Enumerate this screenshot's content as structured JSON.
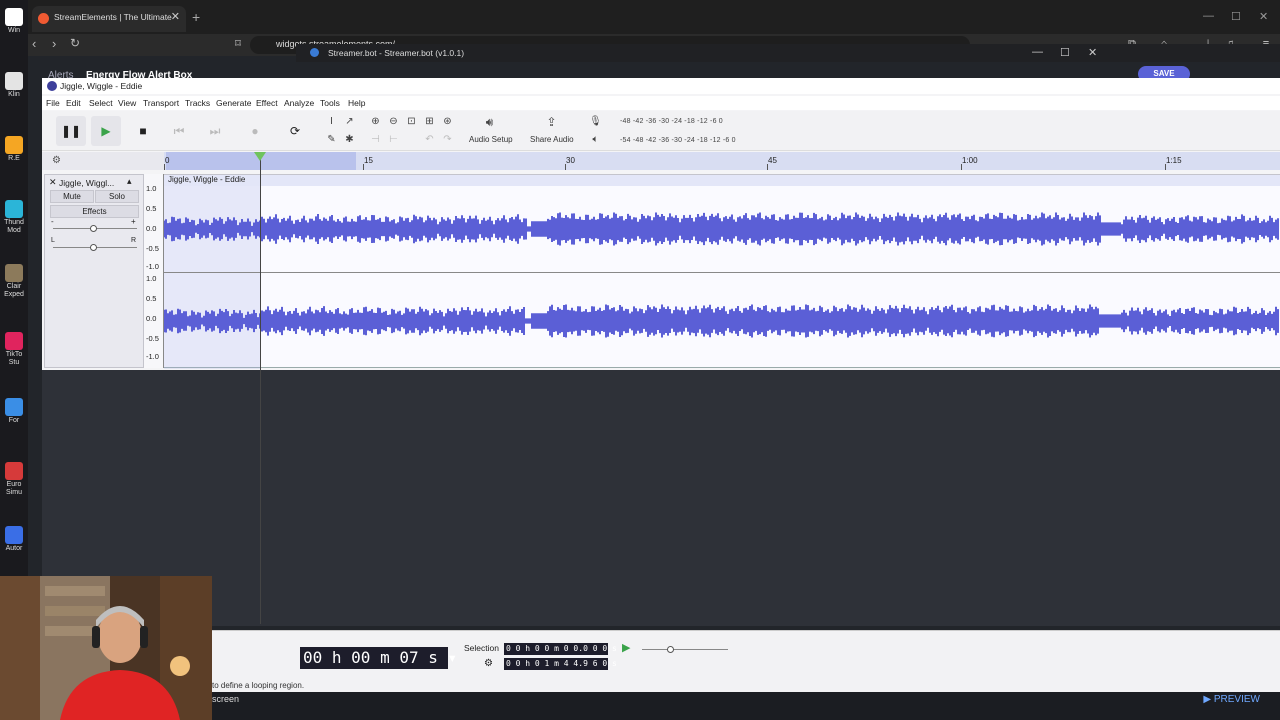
{
  "desktop": {
    "items": [
      {
        "label": "Win",
        "color": "#ffffff"
      },
      {
        "label": "Klin",
        "color": "#e4e4e4"
      },
      {
        "label": "R.E",
        "color": "#f5a623"
      },
      {
        "label": "Thund Mod",
        "color": "#2bb5d8"
      },
      {
        "label": "Clair Exped",
        "color": "#8c7a5b"
      },
      {
        "label": "TikTo Stu",
        "color": "#e0245e"
      },
      {
        "label": "For",
        "color": "#3a8ee6"
      },
      {
        "label": "Euro Simu",
        "color": "#d63a3a"
      },
      {
        "label": "Autor",
        "color": "#3a6ee6"
      }
    ]
  },
  "browser": {
    "tab_title": "StreamElements | The Ultimate",
    "url": "widgets.streamelements.com/",
    "page": {
      "breadcrumb_parent": "Alerts",
      "breadcrumb_current": "Energy Flow Alert Box",
      "save_label": "SAVE",
      "preview_label": "▶ PREVIEW",
      "screen_label": "screen"
    }
  },
  "streamerbot": {
    "title": "Streamer.bot - Streamer.bot (v1.0.1)"
  },
  "audacity": {
    "title": "Jiggle, Wiggle - Eddie",
    "menu": [
      "File",
      "Edit",
      "Select",
      "View",
      "Transport",
      "Tracks",
      "Generate",
      "Effect",
      "Analyze",
      "Tools",
      "Help"
    ],
    "toolbar": {
      "audio_setup": "Audio Setup",
      "share_audio": "Share Audio",
      "meter_rec": "-48 -42 -36 -30 -24 -18 -12 -6 0",
      "meter_play": "-54 -48 -42 -36 -30 -24 -18 -12 -6 0"
    },
    "ruler_ticks": [
      "0",
      "15",
      "30",
      "45",
      "1:00",
      "1:15"
    ],
    "track": {
      "name": "Jiggle, Wiggl...",
      "clip_name": "Jiggle, Wiggle - Eddie",
      "mute": "Mute",
      "solo": "Solo",
      "effects": "Effects",
      "gain_minus": "-",
      "gain_plus": "+",
      "pan_l": "L",
      "pan_r": "R",
      "scale_top": [
        "1.0",
        "0.5",
        "0.0",
        "-0.5",
        "-1.0"
      ],
      "scale_bottom": [
        "1.0",
        "0.5",
        "0.0",
        "-0.5",
        "-1.0"
      ]
    },
    "time": {
      "display": "00 h 00 m 07 s",
      "selection_label": "Selection",
      "selection_start": "0 0 h 0 0 m 0 0.0 0 0 s",
      "selection_end": "0 0 h 0 1 m 4 4.9 6 0 s"
    },
    "status": "to define a looping region.",
    "colors": {
      "waveform": "#5b5fd6",
      "selection": "#b9c2ec",
      "timer_bg": "#1d1d2b"
    }
  }
}
